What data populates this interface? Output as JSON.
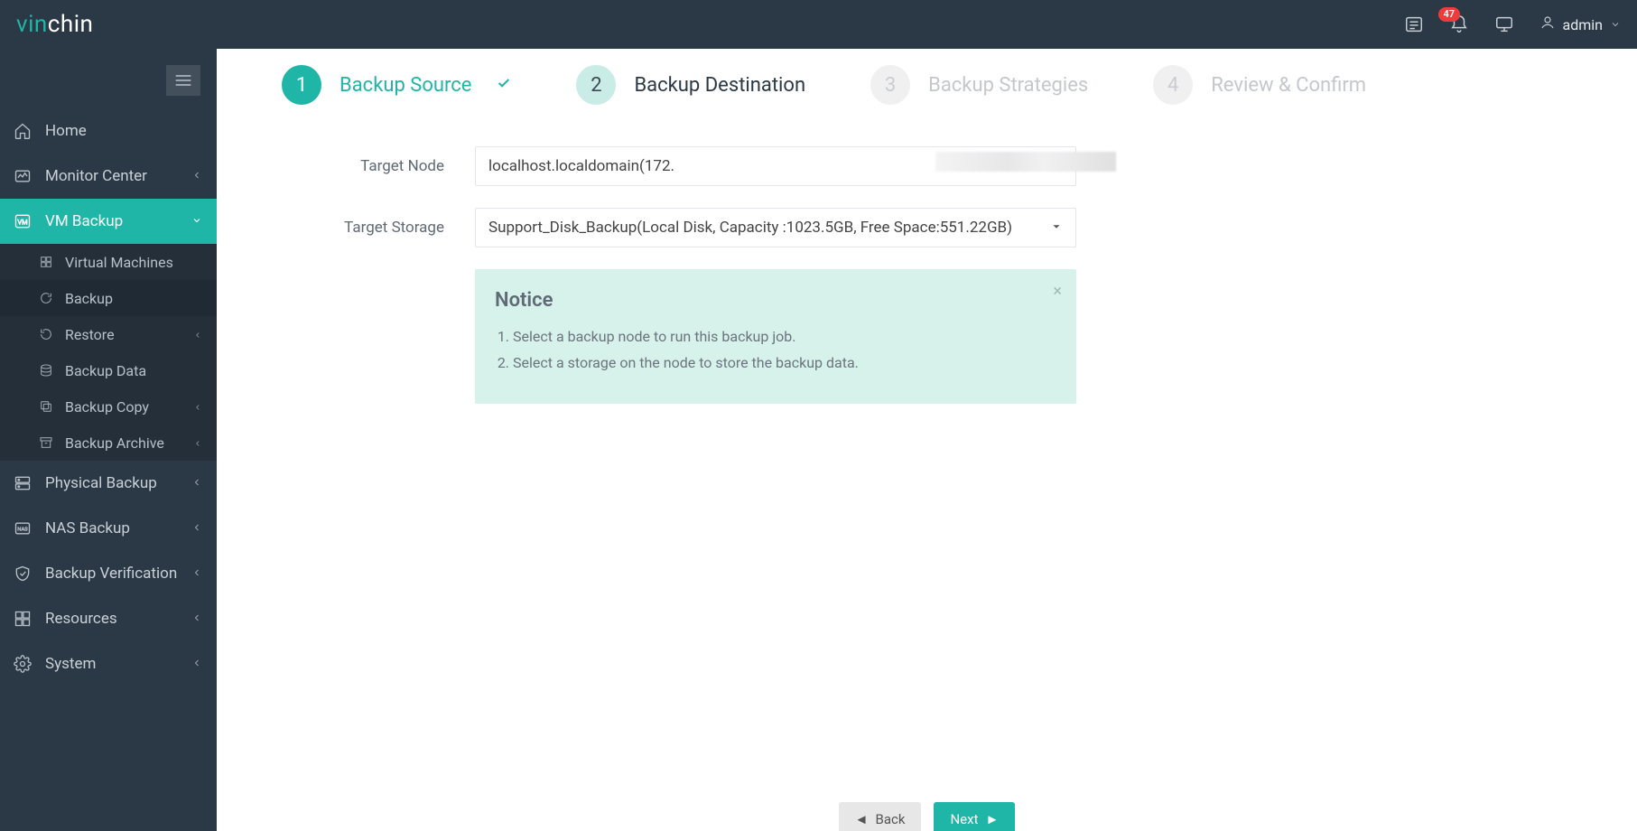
{
  "brand": {
    "prefix": "vin",
    "suffix": "chin"
  },
  "topbar": {
    "notification_count": "47",
    "user": "admin"
  },
  "sidebar": {
    "items": [
      {
        "label": "Home"
      },
      {
        "label": "Monitor Center"
      },
      {
        "label": "VM Backup"
      },
      {
        "label": "Physical Backup"
      },
      {
        "label": "NAS Backup"
      },
      {
        "label": "Backup Verification"
      },
      {
        "label": "Resources"
      },
      {
        "label": "System"
      }
    ],
    "vm_sub": [
      {
        "label": "Virtual Machines"
      },
      {
        "label": "Backup"
      },
      {
        "label": "Restore"
      },
      {
        "label": "Backup Data"
      },
      {
        "label": "Backup Copy"
      },
      {
        "label": "Backup Archive"
      }
    ]
  },
  "steps": {
    "s1": {
      "num": "1",
      "label": "Backup Source"
    },
    "s2": {
      "num": "2",
      "label": "Backup Destination"
    },
    "s3": {
      "num": "3",
      "label": "Backup Strategies"
    },
    "s4": {
      "num": "4",
      "label": "Review & Confirm"
    }
  },
  "form": {
    "target_node": {
      "label": "Target Node",
      "value": "localhost.localdomain(172."
    },
    "target_storage": {
      "label": "Target Storage",
      "value": "Support_Disk_Backup(Local Disk, Capacity :1023.5GB, Free Space:551.22GB)"
    }
  },
  "notice": {
    "title": "Notice",
    "items": [
      "Select a backup node to run this backup job.",
      "Select a storage on the node to store the backup data."
    ]
  },
  "footer": {
    "back": "Back",
    "next": "Next"
  }
}
